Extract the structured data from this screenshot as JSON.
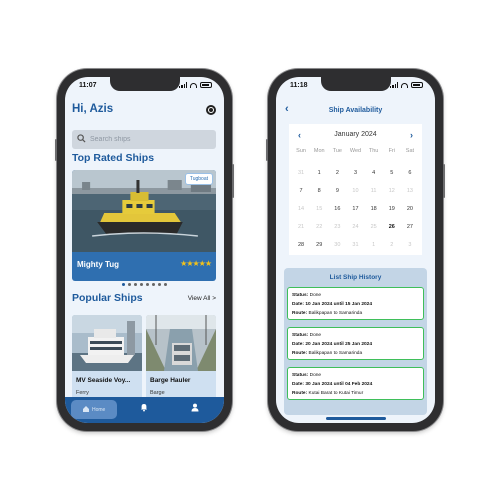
{
  "status_bar": {
    "left_time": "11:07",
    "right_time": "11:18"
  },
  "home": {
    "greeting": "Hi, Azis",
    "search_placeholder": "Search ships",
    "top_rated_title": "Top Rated Ships",
    "featured": {
      "name": "Mighty Tug",
      "badge": "Tugboat",
      "stars": "★★★★★",
      "rating_stars": 5
    },
    "carousel_pages": 8,
    "carousel_active_index": 0,
    "popular_title": "Popular Ships",
    "view_all_label": "View All >",
    "popular": [
      {
        "name": "MV Seaside Voy...",
        "type": "Ferry"
      },
      {
        "name": "Barge Hauler",
        "type": "Barge"
      }
    ],
    "nav": {
      "home_label": "Home"
    }
  },
  "availability": {
    "page_title": "Ship Availability",
    "calendar": {
      "month": "January 2024",
      "weekdays": [
        "Sun",
        "Mon",
        "Tue",
        "Wed",
        "Thu",
        "Fri",
        "Sat"
      ],
      "weeks": [
        [
          {
            "d": "31",
            "s": "faded"
          },
          {
            "d": "1",
            "s": ""
          },
          {
            "d": "2",
            "s": ""
          },
          {
            "d": "3",
            "s": ""
          },
          {
            "d": "4",
            "s": ""
          },
          {
            "d": "5",
            "s": ""
          },
          {
            "d": "6",
            "s": ""
          }
        ],
        [
          {
            "d": "7",
            "s": ""
          },
          {
            "d": "8",
            "s": ""
          },
          {
            "d": "9",
            "s": ""
          },
          {
            "d": "10",
            "s": "faded"
          },
          {
            "d": "11",
            "s": "faded"
          },
          {
            "d": "12",
            "s": "faded"
          },
          {
            "d": "13",
            "s": "faded"
          }
        ],
        [
          {
            "d": "14",
            "s": "faded"
          },
          {
            "d": "15",
            "s": "faded"
          },
          {
            "d": "16",
            "s": ""
          },
          {
            "d": "17",
            "s": ""
          },
          {
            "d": "18",
            "s": ""
          },
          {
            "d": "19",
            "s": ""
          },
          {
            "d": "20",
            "s": ""
          }
        ],
        [
          {
            "d": "21",
            "s": "faded"
          },
          {
            "d": "22",
            "s": "faded"
          },
          {
            "d": "23",
            "s": "faded"
          },
          {
            "d": "24",
            "s": "faded"
          },
          {
            "d": "25",
            "s": "faded"
          },
          {
            "d": "26",
            "s": "strong"
          },
          {
            "d": "27",
            "s": ""
          }
        ],
        [
          {
            "d": "28",
            "s": ""
          },
          {
            "d": "29",
            "s": ""
          },
          {
            "d": "30",
            "s": "faded"
          },
          {
            "d": "31",
            "s": "faded"
          },
          {
            "d": "1",
            "s": "faded"
          },
          {
            "d": "2",
            "s": "faded"
          },
          {
            "d": "3",
            "s": "faded"
          }
        ]
      ]
    },
    "history_title": "List Ship History",
    "history": [
      {
        "status_label": "Status:",
        "status": "Done",
        "date_label": "Date:",
        "date": "10 Jan 2024 until 15 Jan 2024",
        "route_label": "Route:",
        "route": "Balikpapan to Samarinda"
      },
      {
        "status_label": "Status:",
        "status": "Done",
        "date_label": "Date:",
        "date": "20 Jan 2024 until 25 Jan 2024",
        "route_label": "Route:",
        "route": "Balikpapan to Samarinda"
      },
      {
        "status_label": "Status:",
        "status": "Done",
        "date_label": "Date:",
        "date": "30 Jan 2024 until 04 Feb 2024",
        "route_label": "Route:",
        "route": "Kutai Barat to Kutai Timur"
      }
    ]
  },
  "colors": {
    "primary": "#1e5a9c",
    "success_border": "#3fbf5a",
    "star": "#f2c21b",
    "panel": "#c3d5e6"
  }
}
